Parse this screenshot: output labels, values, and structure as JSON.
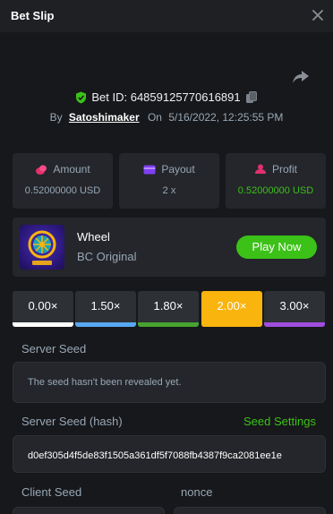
{
  "header": {
    "title": "Bet Slip"
  },
  "bet": {
    "id_label": "Bet ID: 648591257706168‌91",
    "by_label": "By",
    "user": "Satoshimaker",
    "on_label": "On",
    "time": "5/16/2022, 12:25:55 PM"
  },
  "stats": [
    {
      "label": "Amount",
      "value": "0.52000000 USD",
      "icon": "coins-icon"
    },
    {
      "label": "Payout",
      "value": "2 x",
      "icon": "card-icon"
    },
    {
      "label": "Profit",
      "value": "0.52000000 USD",
      "icon": "profit-icon"
    }
  ],
  "game": {
    "name": "Wheel",
    "sub": "BC Original",
    "play_label": "Play Now"
  },
  "multipliers": [
    {
      "label": "0.00×",
      "color": "#ffffff"
    },
    {
      "label": "1.50×",
      "color": "#58a8f3"
    },
    {
      "label": "1.80×",
      "color": "#47a32f"
    },
    {
      "label": "2.00×",
      "color": "#f9b40e"
    },
    {
      "label": "3.00×",
      "color": "#a04de0"
    }
  ],
  "seeds": {
    "server_label": "Server Seed",
    "server_value": "The seed hasn't been revealed yet.",
    "hash_label": "Server Seed (hash)",
    "settings_label": "Seed Settings",
    "hash_value": "d0ef305d4f5de83f1505a361df5f7088fb4387f9ca2081ee1e",
    "client_label": "Client Seed",
    "nonce_label": "nonce"
  },
  "colors": {
    "accent_green": "#3bc117",
    "active_multiplier": "#f9b40e",
    "background": "#17181b"
  }
}
